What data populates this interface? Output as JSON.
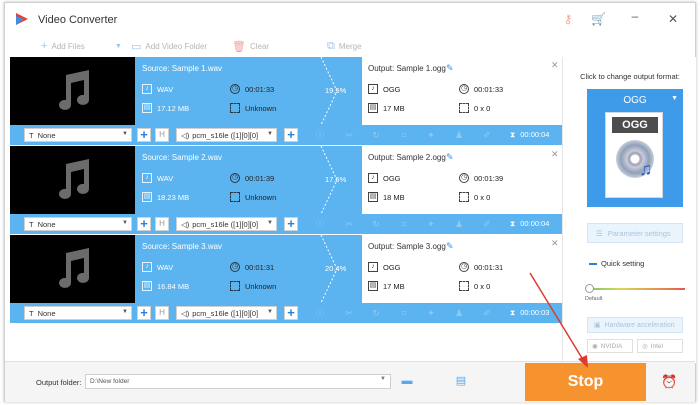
{
  "app": {
    "title": "Video Converter"
  },
  "toolbar": {
    "add_files": "Add Files",
    "add_video_folder": "Add Video Folder",
    "clear": "Clear",
    "merge": "Merge"
  },
  "tasks": [
    {
      "source": "Source: Sample 1.wav",
      "src_format": "WAV",
      "src_size": "17.12 MB",
      "src_duration": "00:01:33",
      "src_resolution": "Unknown",
      "progress": "19.5%",
      "output": "Output: Sample 1.ogg",
      "out_format": "OGG",
      "out_size": "17 MB",
      "out_duration": "00:01:33",
      "out_resolution": "0 x 0",
      "subtitle": "None",
      "audio_track": "pcm_s16le ([1][0][0]",
      "trim_duration": "00:00:04"
    },
    {
      "source": "Source: Sample 2.wav",
      "src_format": "WAV",
      "src_size": "18.23 MB",
      "src_duration": "00:01:39",
      "src_resolution": "Unknown",
      "progress": "17.6%",
      "output": "Output: Sample 2.ogg",
      "out_format": "OGG",
      "out_size": "18 MB",
      "out_duration": "00:01:39",
      "out_resolution": "0 x 0",
      "subtitle": "None",
      "audio_track": "pcm_s16le ([1][0][0]",
      "trim_duration": "00:00:04"
    },
    {
      "source": "Source: Sample 3.wav",
      "src_format": "WAV",
      "src_size": "16.84 MB",
      "src_duration": "00:01:31",
      "src_resolution": "Unknown",
      "progress": "20.4%",
      "output": "Output: Sample 3.ogg",
      "out_format": "OGG",
      "out_size": "17 MB",
      "out_duration": "00:01:31",
      "out_resolution": "0 x 0",
      "subtitle": "None",
      "audio_track": "pcm_s16le ([1][0][0]",
      "trim_duration": "00:00:03"
    }
  ],
  "right_panel": {
    "change_label": "Click to change output format:",
    "format": "OGG",
    "format_image_label": "OGG",
    "parameter_settings": "Parameter settings",
    "quick_setting": "Quick setting",
    "slider_default": "Default",
    "hardware_acceleration": "Hardware acceleration",
    "nvidia": "NVIDIA",
    "intel": "Intel"
  },
  "bottom": {
    "output_folder_label": "Output folder:",
    "output_folder_value": "D:\\New folder",
    "stop": "Stop"
  },
  "colors": {
    "accent_blue": "#5bb4ef",
    "stop_orange": "#f7932f",
    "annotation_arrow": "#e03a2f"
  }
}
